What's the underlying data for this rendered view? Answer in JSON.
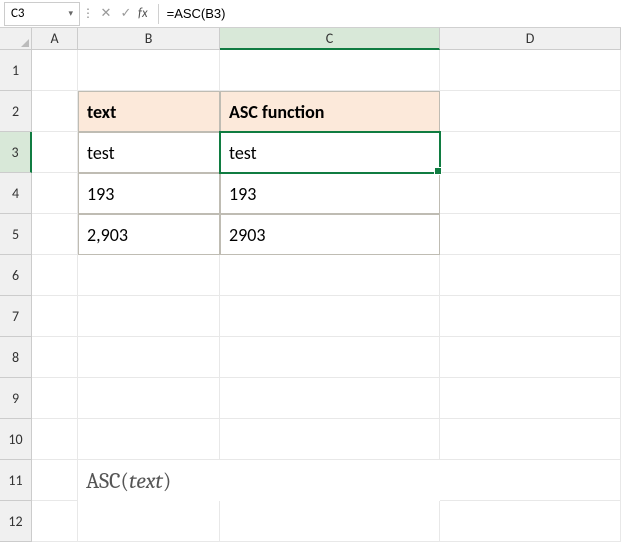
{
  "nameBox": "C3",
  "formula": "=ASC(B3)",
  "columns": [
    "A",
    "B",
    "C",
    "D"
  ],
  "rowNumbers": [
    "1",
    "2",
    "3",
    "4",
    "5",
    "6",
    "7",
    "8",
    "9",
    "10",
    "11",
    "12"
  ],
  "headers": {
    "b2": "text",
    "c2": "ASC function"
  },
  "cells": {
    "b3": "test",
    "c3": "test",
    "b4": "193",
    "c4": "193",
    "b5": "2,903",
    "c5": "2903"
  },
  "syntax": {
    "fn": "ASC(",
    "arg": "text",
    "close": ")"
  },
  "activeCell": "C3"
}
